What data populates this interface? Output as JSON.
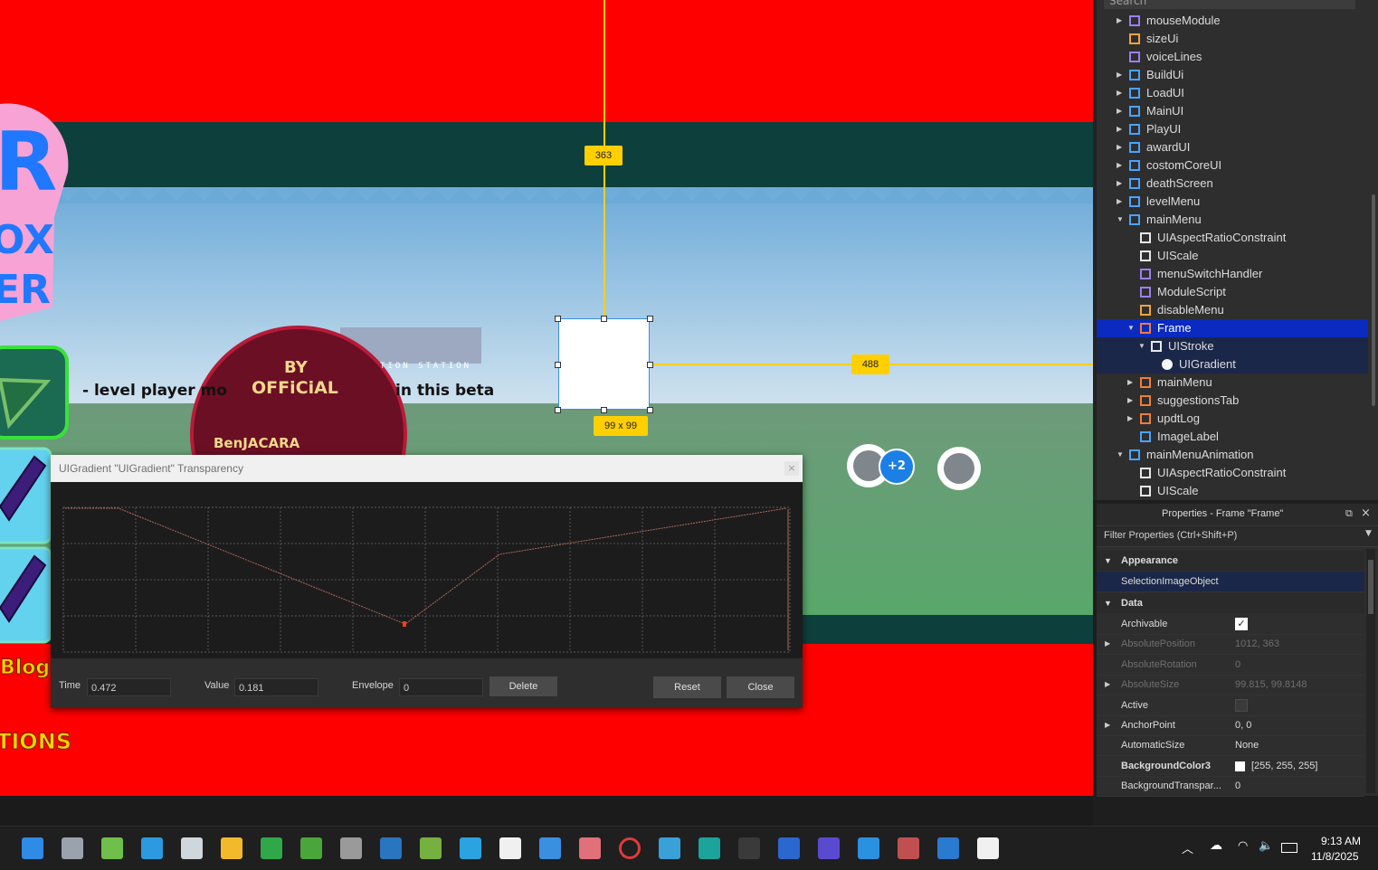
{
  "viewport": {
    "measure_top": "363",
    "measure_right": "488",
    "selection_size": "99 x 99",
    "level_text": "- level player mo",
    "beta_text": "in this beta",
    "station_text": "TION STATION",
    "badge_line1": "BY",
    "badge_line2": "OFFiCiAL",
    "badge_line3": "BenJACARA",
    "blog_text": "Blog",
    "tions_text": "TIONS",
    "plus_count": "+2"
  },
  "dialog": {
    "title": "UIGradient \"UIGradient\" Transparency",
    "close_glyph": "×",
    "time_label": "Time",
    "time_value": "0.472",
    "value_label": "Value",
    "value_value": "0.181",
    "envelope_label": "Envelope",
    "envelope_value": "0",
    "delete_label": "Delete",
    "reset_label": "Reset",
    "close_label": "Close"
  },
  "explorer": {
    "search_placeholder": "Search",
    "items": [
      {
        "label": "mouseModule",
        "icon": "module-script-icon",
        "indent": 0,
        "caret": "right"
      },
      {
        "label": "sizeUi",
        "icon": "local-script-icon",
        "indent": 0,
        "caret": ""
      },
      {
        "label": "voiceLines",
        "icon": "module-script-icon",
        "indent": 0,
        "caret": ""
      },
      {
        "label": "BuildUi",
        "icon": "screen-gui-icon",
        "indent": 0,
        "caret": "right"
      },
      {
        "label": "LoadUI",
        "icon": "screen-gui-icon",
        "indent": 0,
        "caret": "right"
      },
      {
        "label": "MainUI",
        "icon": "screen-gui-icon",
        "indent": 0,
        "caret": "right"
      },
      {
        "label": "PlayUI",
        "icon": "screen-gui-icon",
        "indent": 0,
        "caret": "right"
      },
      {
        "label": "awardUI",
        "icon": "screen-gui-icon",
        "indent": 0,
        "caret": "right"
      },
      {
        "label": "costomCoreUI",
        "icon": "screen-gui-icon",
        "indent": 0,
        "caret": "right"
      },
      {
        "label": "deathScreen",
        "icon": "screen-gui-icon",
        "indent": 0,
        "caret": "right"
      },
      {
        "label": "levelMenu",
        "icon": "screen-gui-icon",
        "indent": 0,
        "caret": "right"
      },
      {
        "label": "mainMenu",
        "icon": "screen-gui-icon",
        "indent": 0,
        "caret": "down"
      },
      {
        "label": "UIAspectRatioConstraint",
        "icon": "aspect-ratio-icon",
        "indent": 1,
        "caret": ""
      },
      {
        "label": "UIScale",
        "icon": "ui-scale-icon",
        "indent": 1,
        "caret": ""
      },
      {
        "label": "menuSwitchHandler",
        "icon": "module-script-icon",
        "indent": 1,
        "caret": ""
      },
      {
        "label": "ModuleScript",
        "icon": "module-script-icon",
        "indent": 1,
        "caret": ""
      },
      {
        "label": "disableMenu",
        "icon": "local-script-icon",
        "indent": 1,
        "caret": ""
      },
      {
        "label": "Frame",
        "icon": "frame-icon",
        "indent": 1,
        "caret": "down",
        "state": "selected"
      },
      {
        "label": "UIStroke",
        "icon": "ui-stroke-icon",
        "indent": 2,
        "caret": "down",
        "state": "child"
      },
      {
        "label": "UIGradient",
        "icon": "ui-gradient-icon",
        "indent": 3,
        "caret": "",
        "state": "child"
      },
      {
        "label": "mainMenu",
        "icon": "frame-icon",
        "indent": 1,
        "caret": "right"
      },
      {
        "label": "suggestionsTab",
        "icon": "frame-icon",
        "indent": 1,
        "caret": "right"
      },
      {
        "label": "updtLog",
        "icon": "frame-icon",
        "indent": 1,
        "caret": "right"
      },
      {
        "label": "ImageLabel",
        "icon": "image-label-icon",
        "indent": 1,
        "caret": ""
      },
      {
        "label": "mainMenuAnimation",
        "icon": "screen-gui-icon",
        "indent": 0,
        "caret": "down"
      },
      {
        "label": "UIAspectRatioConstraint",
        "icon": "aspect-ratio-icon",
        "indent": 1,
        "caret": ""
      },
      {
        "label": "UIScale",
        "icon": "ui-scale-icon",
        "indent": 1,
        "caret": ""
      }
    ]
  },
  "properties": {
    "title": "Properties - Frame \"Frame\"",
    "filter_placeholder": "Filter Properties (Ctrl+Shift+P)",
    "cat_appearance": "Appearance",
    "selection_image_object": "SelectionImageObject",
    "cat_data": "Data",
    "rows": [
      {
        "name": "Archivable",
        "value": "",
        "checkbox": "checked",
        "disabled": false,
        "caret": false,
        "bold": false
      },
      {
        "name": "AbsolutePosition",
        "value": "1012, 363",
        "checkbox": "",
        "disabled": true,
        "caret": true,
        "bold": false
      },
      {
        "name": "AbsoluteRotation",
        "value": "0",
        "checkbox": "",
        "disabled": true,
        "caret": false,
        "bold": false
      },
      {
        "name": "AbsoluteSize",
        "value": "99.815, 99.8148",
        "checkbox": "",
        "disabled": true,
        "caret": true,
        "bold": false
      },
      {
        "name": "Active",
        "value": "",
        "checkbox": "unchecked",
        "disabled": false,
        "caret": false,
        "bold": false
      },
      {
        "name": "AnchorPoint",
        "value": "0, 0",
        "checkbox": "",
        "disabled": false,
        "caret": true,
        "bold": false
      },
      {
        "name": "AutomaticSize",
        "value": "None",
        "checkbox": "",
        "disabled": false,
        "caret": false,
        "bold": false
      },
      {
        "name": "BackgroundColor3",
        "value": "[255, 255, 255]",
        "checkbox": "swatch",
        "disabled": false,
        "caret": false,
        "bold": true
      },
      {
        "name": "BackgroundTranspar...",
        "value": "0",
        "checkbox": "",
        "disabled": false,
        "caret": false,
        "bold": false
      }
    ]
  },
  "taskbar": {
    "time": "9:13 AM",
    "date": "11/8/2025",
    "apps": [
      "windows-start-icon",
      "task-view-icon",
      "notepad-icon",
      "edge-icon",
      "unity-icon",
      "file-explorer-icon",
      "xbox-icon",
      "minecraft-icon",
      "microphone-icon",
      "steam-icon",
      "gpu-icon",
      "telegram-icon",
      "capcut-icon",
      "paint-icon",
      "photos-icon",
      "opera-icon",
      "calendar-grid-icon",
      "arduino-icon",
      "headset-icon",
      "face-app-icon",
      "tetris-icon",
      "edge-dev-icon",
      "game-icon",
      "window-icon",
      "roblox-studio-icon"
    ]
  },
  "colors": {
    "viewport_bg": "#ff0000",
    "selection_blue": "#0b2ac0",
    "badge_yellow": "#ffcf00"
  }
}
